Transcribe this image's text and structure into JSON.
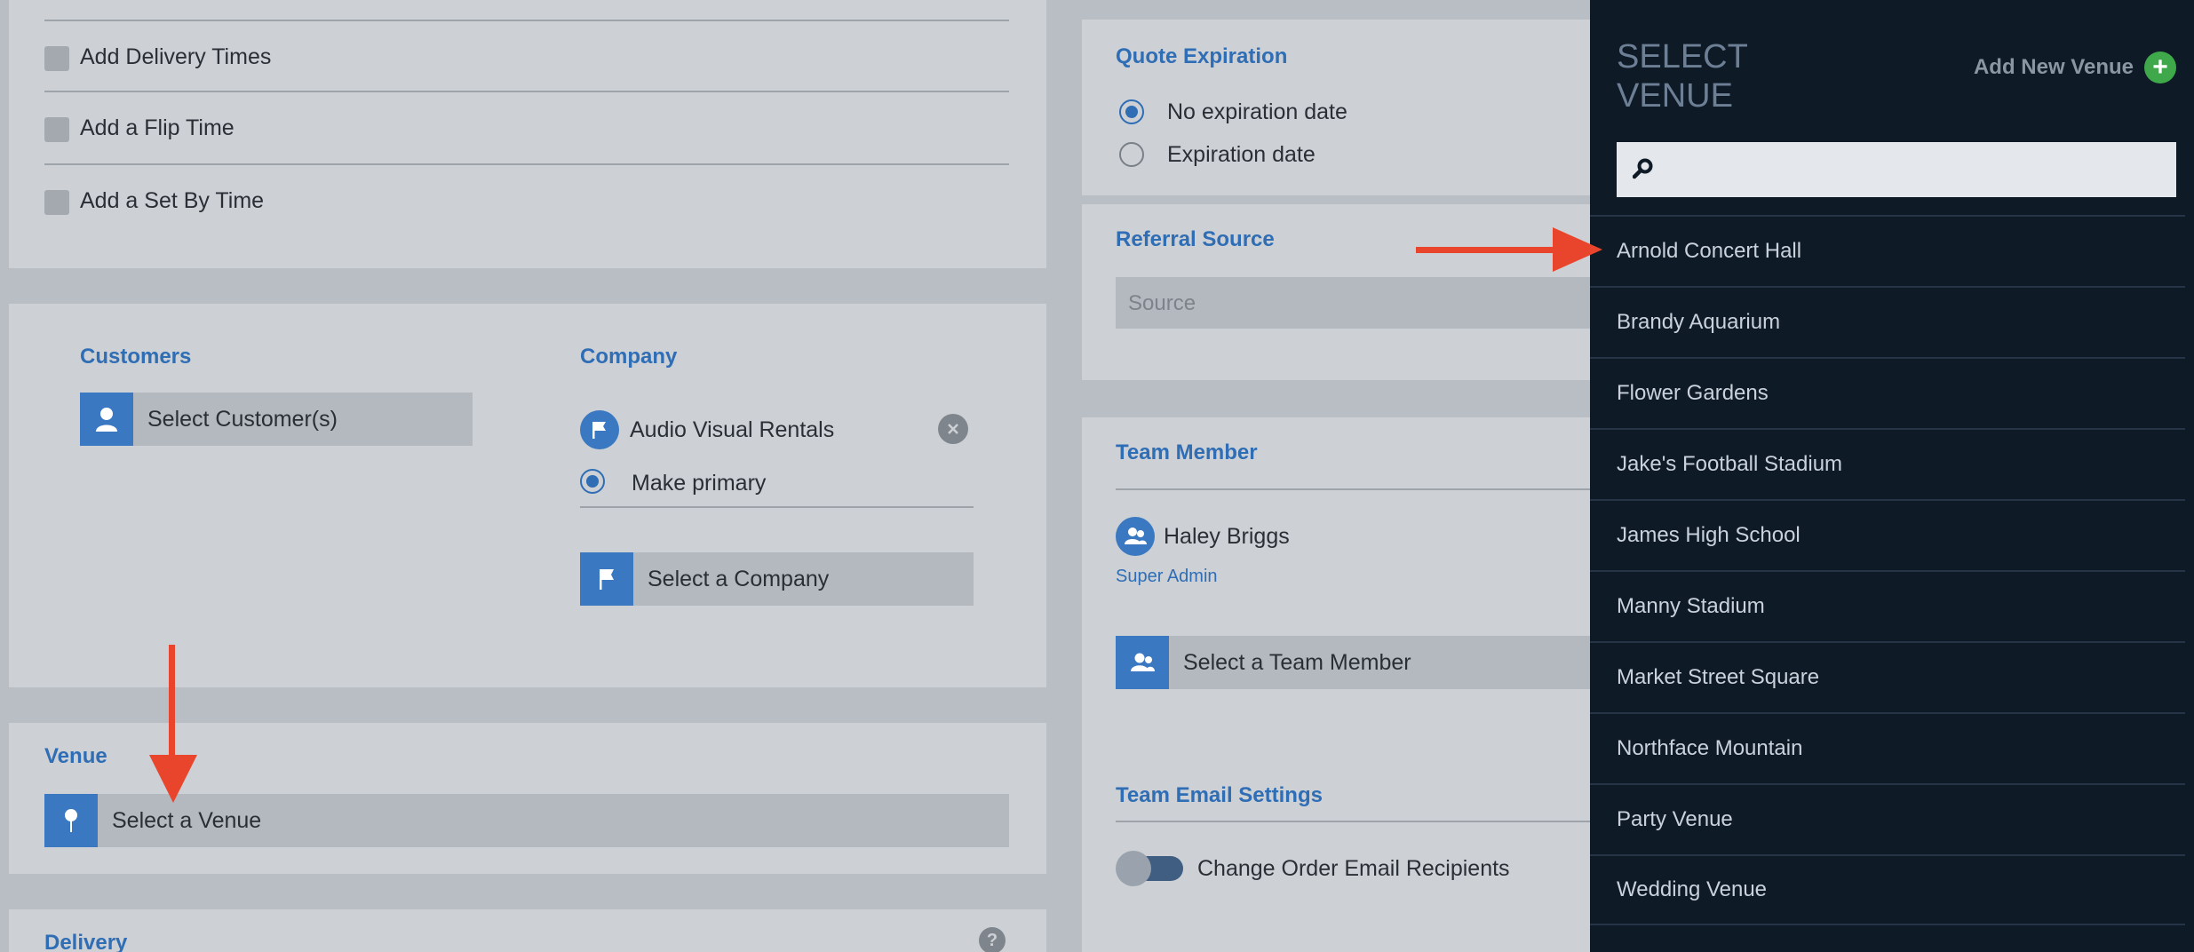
{
  "options": {
    "rows": [
      "Add Delivery Times",
      "Add a Flip Time",
      "Add a Set By Time"
    ]
  },
  "customers": {
    "label": "Customers",
    "select_label": "Select Customer(s)"
  },
  "company": {
    "label": "Company",
    "current": "Audio Visual Rentals",
    "make_primary": "Make primary",
    "select_label": "Select a Company"
  },
  "venue": {
    "label": "Venue",
    "select_label": "Select a Venue"
  },
  "delivery": {
    "label": "Delivery",
    "help": "?"
  },
  "quote_expiration": {
    "label": "Quote Expiration",
    "options": [
      "No expiration date",
      "Expiration date"
    ],
    "selected": "No expiration date"
  },
  "referral": {
    "label": "Referral Source",
    "placeholder": "Source"
  },
  "team_member": {
    "label": "Team Member",
    "member_name": "Haley Briggs",
    "member_role": "Super Admin",
    "select_label": "Select a Team Member"
  },
  "team_email": {
    "label": "Team Email Settings",
    "toggle_label": "Change Order Email Recipients"
  },
  "sidebar": {
    "title": "SELECT VENUE",
    "add_label": "Add New Venue",
    "search_placeholder": "",
    "venues": [
      "Arnold Concert Hall",
      "Brandy Aquarium",
      "Flower Gardens",
      "Jake's Football Stadium",
      "James High School",
      "Manny Stadium",
      "Market Street Square",
      "Northface Mountain",
      "Party Venue",
      "Wedding Venue"
    ]
  },
  "colors": {
    "accent": "#3a78c2",
    "annotation_arrow": "#e8452c",
    "sidebar_bg": "#0f1a27",
    "add_button": "#3fa84a"
  }
}
